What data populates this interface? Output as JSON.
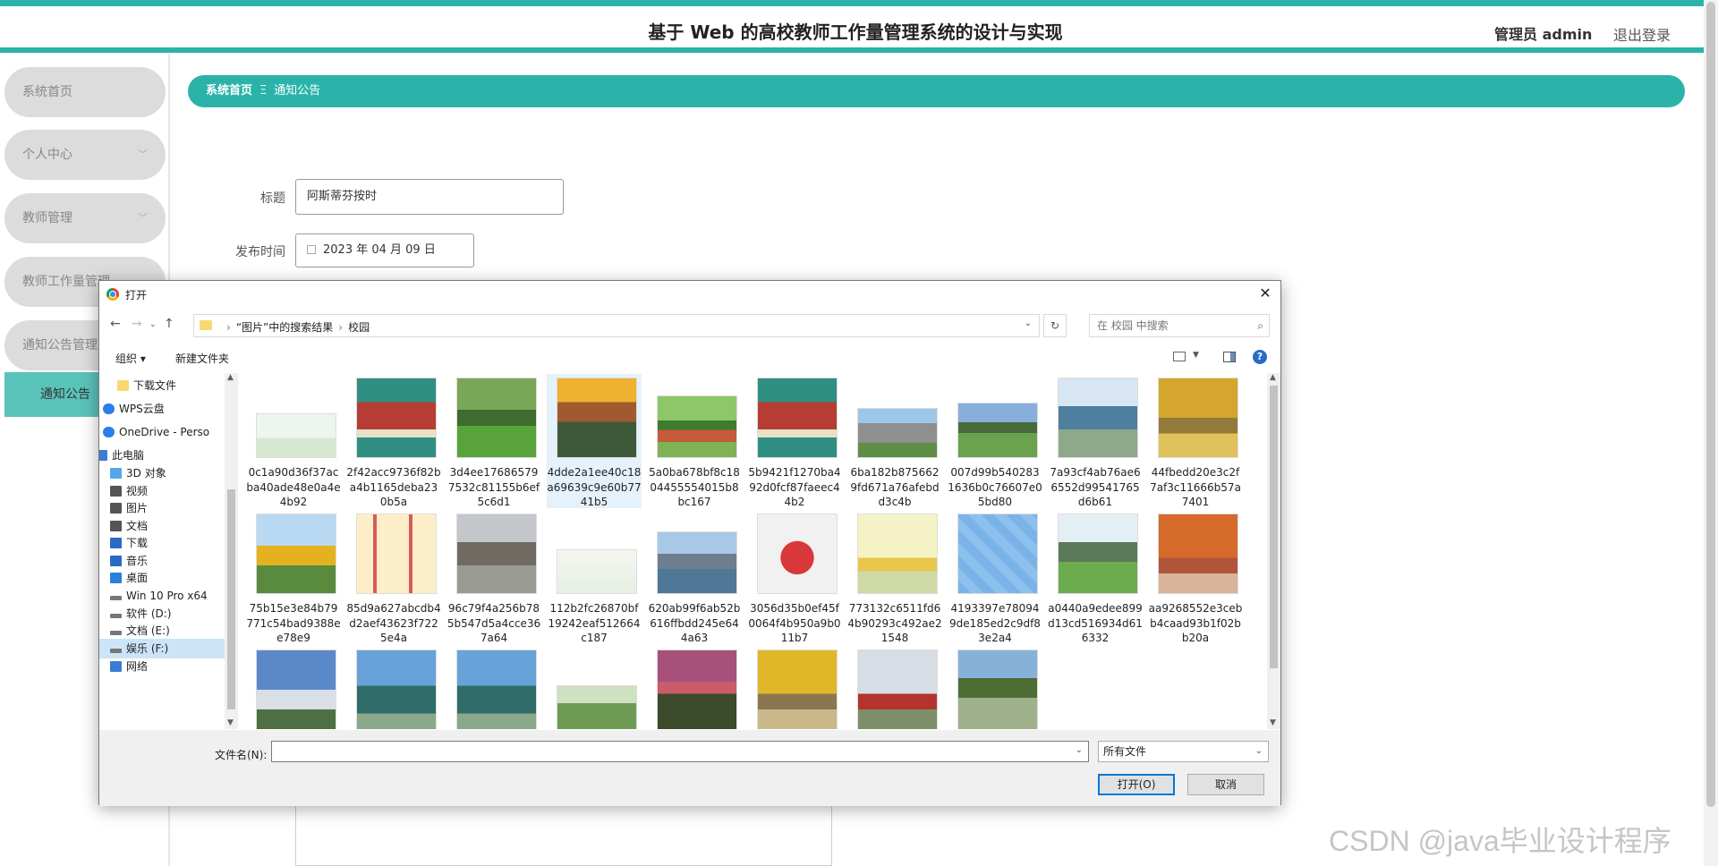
{
  "header": {
    "title": "基于 Web 的高校教师工作量管理系统的设计与实现",
    "admin": "管理员 admin",
    "logout": "退出登录"
  },
  "sidebar": {
    "items": [
      {
        "label": "系统首页"
      },
      {
        "label": "个人中心"
      },
      {
        "label": "教师管理"
      },
      {
        "label": "教师工作量管理"
      },
      {
        "label": "通知公告管理"
      }
    ],
    "active": "通知公告"
  },
  "breadcrumb": {
    "home": "系统首页",
    "sep": "Ξ",
    "current": "通知公告"
  },
  "form": {
    "title_label": "标题",
    "title_value": "阿斯蒂芬按时",
    "date_label": "发布时间",
    "date_value": "2023 年 04 月 09 日"
  },
  "dialog": {
    "title": "打开",
    "path": [
      "“图片”中的搜索结果",
      "校园"
    ],
    "search_placeholder": "在 校园 中搜索",
    "organize": "组织 ▾",
    "new_folder": "新建文件夹",
    "tree": [
      {
        "label": "下载文件",
        "icon": "folder-icon"
      },
      {
        "label": "WPS云盘",
        "icon": "cloud-icon"
      },
      {
        "label": "OneDrive - Perso",
        "icon": "cloud-icon"
      },
      {
        "label": "此电脑",
        "icon": "computer-icon"
      },
      {
        "label": "3D 对象",
        "icon": "3d-icon"
      },
      {
        "label": "视频",
        "icon": "video-icon"
      },
      {
        "label": "图片",
        "icon": "picture-icon"
      },
      {
        "label": "文档",
        "icon": "document-icon"
      },
      {
        "label": "下载",
        "icon": "download-icon"
      },
      {
        "label": "音乐",
        "icon": "music-icon"
      },
      {
        "label": "桌面",
        "icon": "desktop-icon"
      },
      {
        "label": "Win 10 Pro x64",
        "icon": "drive-icon"
      },
      {
        "label": "软件 (D:)",
        "icon": "drive-icon"
      },
      {
        "label": "文档 (E:)",
        "icon": "drive-icon"
      },
      {
        "label": "娱乐 (F:)",
        "icon": "drive-icon"
      },
      {
        "label": "网络",
        "icon": "network-icon"
      }
    ],
    "files": [
      {
        "name": "0c1a90d36f37acba40ade48e0a4e4b92",
        "thumb": "campus-illustration"
      },
      {
        "name": "2f42acc9736f82ba4b1165deba230b5a",
        "thumb": "back-to-school"
      },
      {
        "name": "3d4ee176865797532c81155b6ef5c6d1",
        "thumb": "campus-lawn"
      },
      {
        "name": "4dde2a1ee40c18a69639c9e60b7741b5",
        "thumb": "campus-sunset"
      },
      {
        "name": "5a0ba678bf8c1804455554015b8bc167",
        "thumb": "running-track"
      },
      {
        "name": "5b9421f1270ba492d0fcf87faeec44b2",
        "thumb": "back-to-school"
      },
      {
        "name": "6ba182b8756629fd671a76afebdd3c4b",
        "thumb": "campus-building"
      },
      {
        "name": "007d99b5402831636b0c76607e05bd80",
        "thumb": "campus-field"
      },
      {
        "name": "7a93cf4ab76ae66552d99541765d6b61",
        "thumb": "campus-aerial"
      },
      {
        "name": "44fbedd20e3c2f7af3c11666b57a7401",
        "thumb": "ginkgo-road"
      },
      {
        "name": "75b15e3e84b79771c54bad9388ee78e9",
        "thumb": "sculpture"
      },
      {
        "name": "85d9a627abcdb4d2aef43623f7225e4a",
        "thumb": "school-icons"
      },
      {
        "name": "96c79f4a256b785b547d5a4cce367a64",
        "thumb": "campus-plaza"
      },
      {
        "name": "112b2fc26870bf19242eaf512664c187",
        "thumb": "logo-card"
      },
      {
        "name": "620ab99f6ab52b616ffbdd245e644a63",
        "thumb": "lake-building"
      },
      {
        "name": "3056d35b0ef45f0064f4b950a9b011b7",
        "thumb": "school-icon-red"
      },
      {
        "name": "773132c6511fd64b90293c492ae21548",
        "thumb": "school-yellow"
      },
      {
        "name": "4193397e780949de185ed2c9df83e2a4",
        "thumb": "blue-pattern"
      },
      {
        "name": "a0440a9edee899d13cd516934d616332",
        "thumb": "campus-green"
      },
      {
        "name": "aa9268552e3cebb4caad93b1f02bb20a",
        "thumb": "autumn-tree"
      },
      {
        "name": "",
        "thumb": "statue-white"
      },
      {
        "name": "",
        "thumb": "globe-sculpture"
      },
      {
        "name": "",
        "thumb": "globe-sculpture"
      },
      {
        "name": "",
        "thumb": "campus-aerial2"
      },
      {
        "name": "",
        "thumb": "palm-sunset"
      },
      {
        "name": "",
        "thumb": "ginkgo-gate"
      },
      {
        "name": "",
        "thumb": "statue-red"
      },
      {
        "name": "",
        "thumb": "campus-path"
      }
    ],
    "filename_label": "文件名(N):",
    "filename_value": "",
    "filetype": "所有文件",
    "open": "打开(O)",
    "cancel": "取消"
  },
  "watermark": "CSDN @java毕业设计程序",
  "colors": {
    "accent": "#2bb3aa",
    "nav_active": "#5ac3ba"
  }
}
